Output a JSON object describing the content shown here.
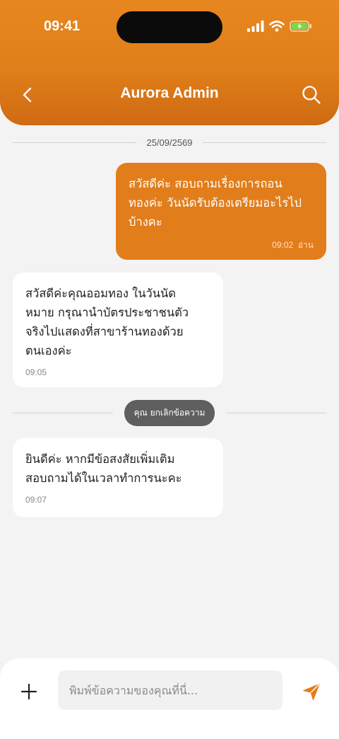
{
  "status_bar": {
    "time": "09:41"
  },
  "header": {
    "title": "Aurora Admin"
  },
  "date_divider": "25/09/2569",
  "messages": [
    {
      "direction": "outgoing",
      "text": "สวัสดีค่ะ สอบถามเรื่องการถอน\nทองค่ะ วันนัดรับต้องเตรียมอะไรไป\nบ้างคะ",
      "time": "09:02",
      "status": "อ่าน"
    },
    {
      "direction": "incoming",
      "text": "สวัสดีค่ะคุณออมทอง ในวันนัด\nหมาย กรุณานำบัตรประชาชนตัว\nจริงไปแสดงที่สาขาร้านทองด้วย\nตนเองค่ะ",
      "time": "09:05"
    },
    {
      "direction": "incoming",
      "text": "ยินดีค่ะ หากมีข้อสงสัยเพิ่มเติม\nสอบถามได้ในเวลาทำการนะคะ",
      "time": "09:07"
    }
  ],
  "system_notice": "คุณ ยกเลิกข้อความ",
  "composer": {
    "placeholder": "พิมพ์ข้อความของคุณที่นี่..."
  },
  "colors": {
    "accent": "#e27d1b",
    "header_dark": "#cf6a12",
    "system_pill": "#5f5f5f",
    "background": "#f3f3f3"
  },
  "icons": {
    "back": "chevron-left-icon",
    "search": "search-icon",
    "add": "plus-icon",
    "send": "send-icon"
  }
}
